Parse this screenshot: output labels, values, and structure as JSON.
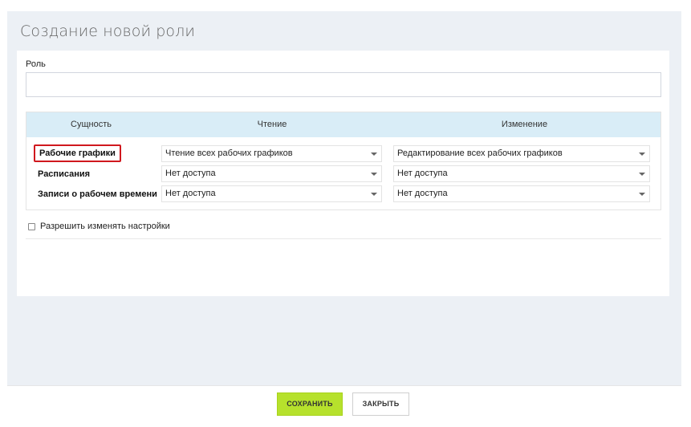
{
  "page": {
    "title": "Создание новой роли"
  },
  "role": {
    "label": "Роль",
    "value": ""
  },
  "permissions": {
    "headers": {
      "entity": "Сущность",
      "read": "Чтение",
      "edit": "Изменение"
    },
    "rows": [
      {
        "entity": "Рабочие графики",
        "read": "Чтение всех рабочих графиков",
        "edit": "Редактирование всех рабочих графиков",
        "highlighted": true
      },
      {
        "entity": "Расписания",
        "read": "Нет доступа",
        "edit": "Нет доступа"
      },
      {
        "entity": "Записи о рабочем времени",
        "read": "Нет доступа",
        "edit": "Нет доступа"
      }
    ]
  },
  "settings": {
    "allow_change_label": "Разрешить изменять настройки",
    "checked": false
  },
  "footer": {
    "save_label": "СОХРАНИТЬ",
    "close_label": "ЗАКРЫТЬ"
  },
  "colors": {
    "save_button": "#b6e12c",
    "header_bg": "#d9edf7",
    "highlight_border": "#d0181e"
  }
}
